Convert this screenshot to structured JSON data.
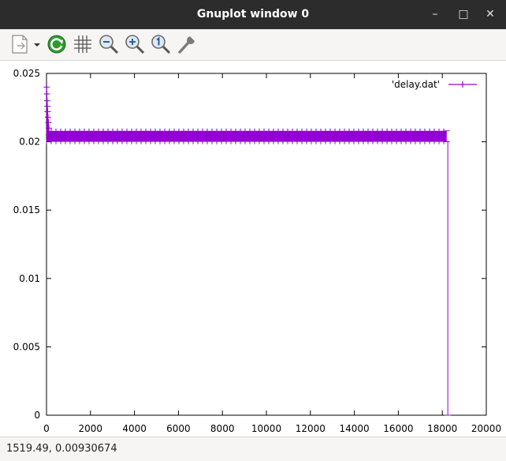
{
  "window": {
    "title": "Gnuplot window 0",
    "minimize_glyph": "–",
    "maximize_glyph": "□",
    "close_glyph": "✕"
  },
  "toolbar": {
    "icons": [
      "copy-to-clipboard-icon",
      "dropdown-arrow-icon",
      "replot-icon",
      "grid-icon",
      "zoom-out-icon",
      "zoom-in-icon",
      "unzoom-icon",
      "configure-icon"
    ]
  },
  "status": {
    "coords": "1519.49,  0.00930674"
  },
  "colors": {
    "series": "#9400d3",
    "titlebar": "#2c2c2c",
    "toolbar": "#f6f5f4"
  },
  "chart_data": {
    "type": "scatter",
    "title": "",
    "xlabel": "",
    "ylabel": "",
    "xlim": [
      0,
      20000
    ],
    "ylim": [
      0,
      0.025
    ],
    "xticks": [
      0,
      2000,
      4000,
      6000,
      8000,
      10000,
      12000,
      14000,
      16000,
      18000,
      20000
    ],
    "xtick_labels": [
      "0",
      "2000",
      "4000",
      "6000",
      "8000",
      "10000",
      "12000",
      "14000",
      "16000",
      "18000",
      "20000"
    ],
    "yticks": [
      0,
      0.005,
      0.01,
      0.015,
      0.02,
      0.025
    ],
    "ytick_labels": [
      "0",
      "0.005",
      "0.01",
      "0.015",
      "0.02",
      "0.025"
    ],
    "legend_position": "top-right",
    "series": [
      {
        "name": "'delay.dat'",
        "band": {
          "x_start": 0,
          "x_end": 18200,
          "y_low": 0.02,
          "y_high": 0.0208
        },
        "early_spikes": [
          {
            "x": 10,
            "y": 0.024
          },
          {
            "x": 20,
            "y": 0.0235
          },
          {
            "x": 30,
            "y": 0.023
          },
          {
            "x": 40,
            "y": 0.0226
          },
          {
            "x": 55,
            "y": 0.0222
          },
          {
            "x": 70,
            "y": 0.0218
          },
          {
            "x": 90,
            "y": 0.0214
          },
          {
            "x": 110,
            "y": 0.021
          }
        ],
        "drop": {
          "x": 18250,
          "y_from": 0.02,
          "y_to": 0
        }
      }
    ]
  }
}
